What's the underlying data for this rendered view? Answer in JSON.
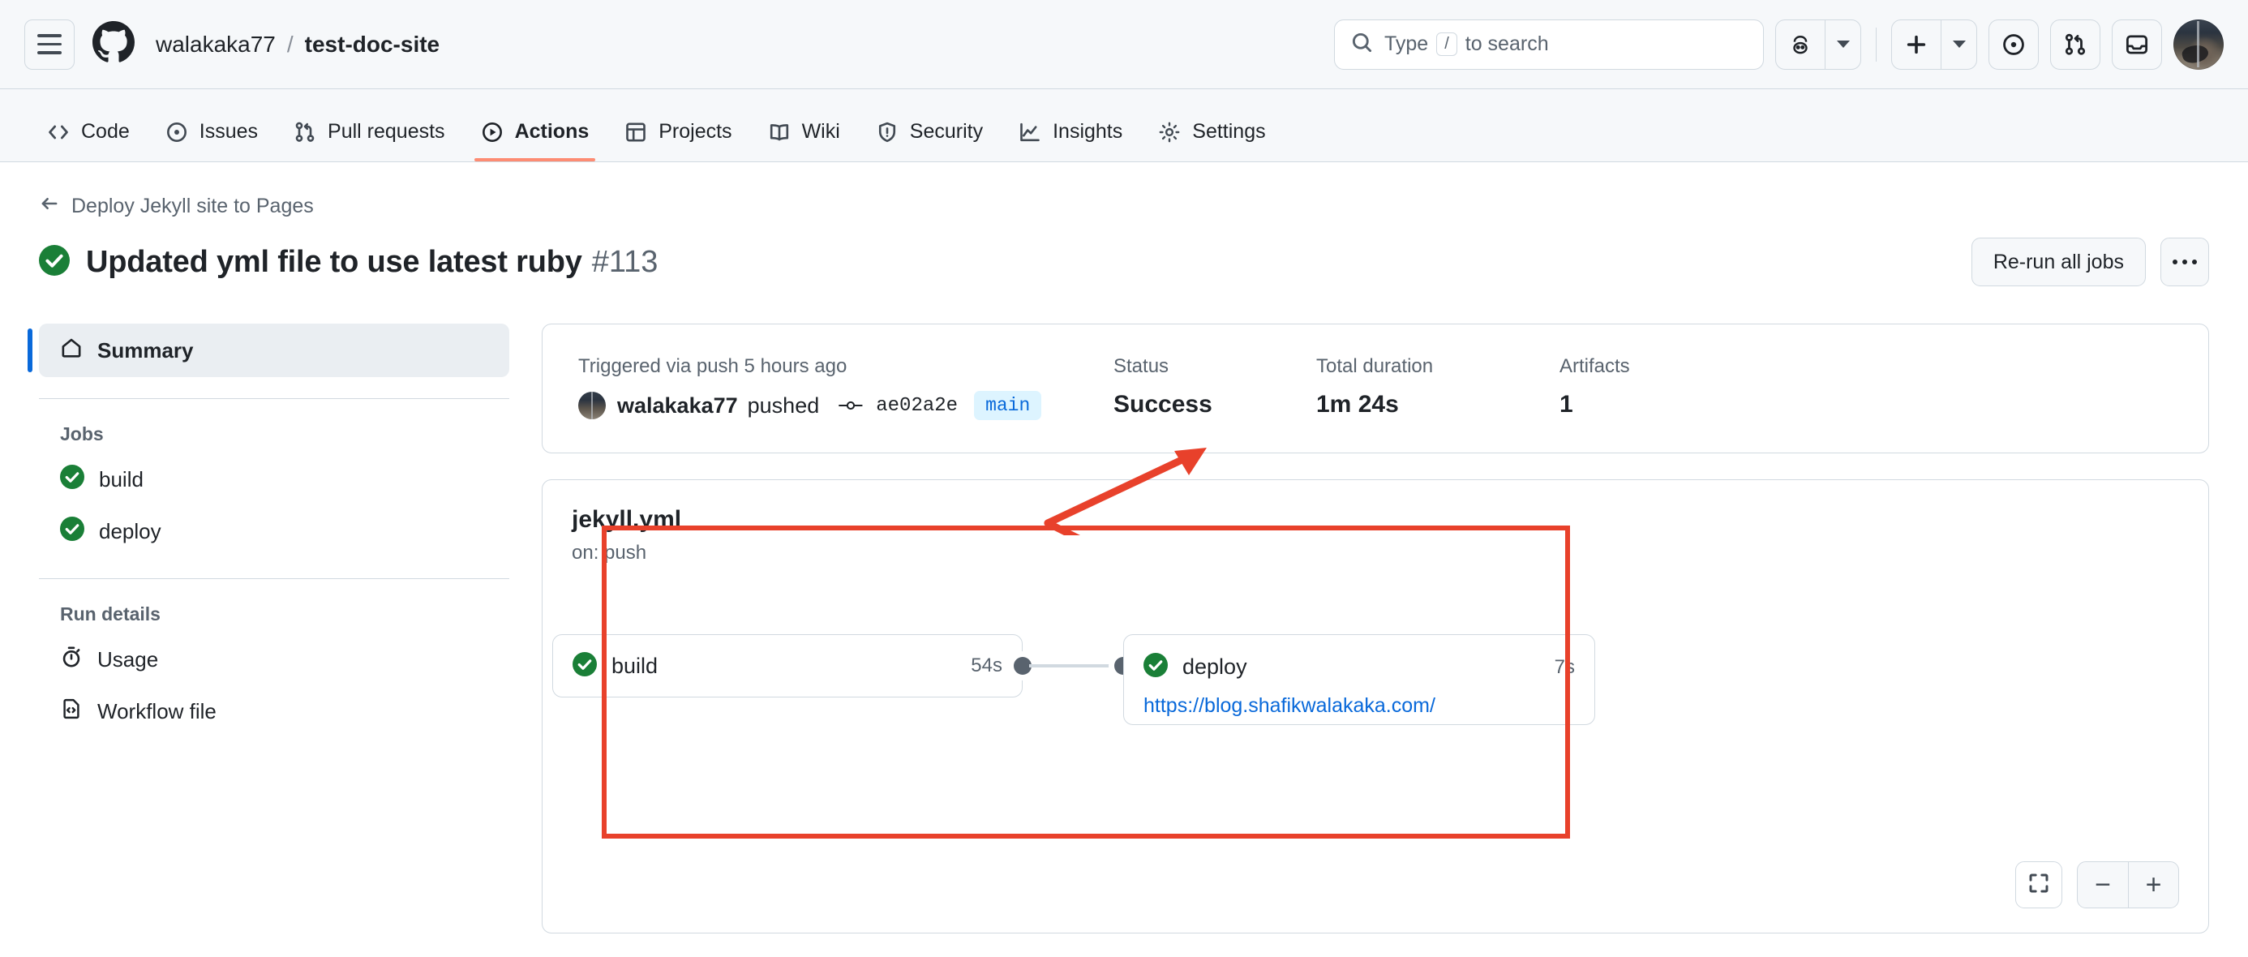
{
  "header": {
    "owner": "walakaka77",
    "separator": "/",
    "repo": "test-doc-site",
    "search_placeholder_pre": "Type",
    "search_slash_key": "/",
    "search_placeholder_post": "to search"
  },
  "repo_nav": [
    {
      "label": "Code",
      "icon": "code-icon",
      "active": false
    },
    {
      "label": "Issues",
      "icon": "issue-opened-icon",
      "active": false
    },
    {
      "label": "Pull requests",
      "icon": "git-pull-request-icon",
      "active": false
    },
    {
      "label": "Actions",
      "icon": "play-icon",
      "active": true
    },
    {
      "label": "Projects",
      "icon": "table-icon",
      "active": false
    },
    {
      "label": "Wiki",
      "icon": "book-icon",
      "active": false
    },
    {
      "label": "Security",
      "icon": "shield-icon",
      "active": false
    },
    {
      "label": "Insights",
      "icon": "graph-icon",
      "active": false
    },
    {
      "label": "Settings",
      "icon": "gear-icon",
      "active": false
    }
  ],
  "run": {
    "back_label": "Deploy Jekyll site to Pages",
    "title": "Updated yml file to use latest ruby",
    "number": "#113",
    "status_icon": "success-check-icon",
    "rerun_label": "Re-run all jobs",
    "kebab_label": "More options"
  },
  "sidebar": {
    "summary_label": "Summary",
    "jobs_heading": "Jobs",
    "jobs": [
      {
        "name": "build",
        "status": "success"
      },
      {
        "name": "deploy",
        "status": "success"
      }
    ],
    "run_details_heading": "Run details",
    "run_details": [
      {
        "label": "Usage",
        "icon": "stopwatch-icon"
      },
      {
        "label": "Workflow file",
        "icon": "file-code-icon"
      }
    ]
  },
  "summary": {
    "triggered_text": "Triggered via push 5 hours ago",
    "actor": "walakaka77",
    "action_verb": "pushed",
    "commit_sha": "ae02a2e",
    "branch": "main",
    "status_label": "Status",
    "status_value": "Success",
    "duration_label": "Total duration",
    "duration_value": "1m 24s",
    "artifacts_label": "Artifacts",
    "artifacts_value": "1"
  },
  "workflow_graph": {
    "file_name": "jekyll.yml",
    "trigger": "on: push",
    "nodes": [
      {
        "name": "build",
        "duration": "54s",
        "status": "success",
        "link": null
      },
      {
        "name": "deploy",
        "duration": "7s",
        "status": "success",
        "link": "https://blog.shafikwalakaka.com/"
      }
    ],
    "zoom_controls": {
      "fit_icon": "fit-screen-icon",
      "zoom_out": "−",
      "zoom_in": "+"
    }
  },
  "annotations": {
    "highlight_color": "#e8412b",
    "arrow_color": "#e8412b",
    "box_target": "workflow-graph-jekyll-yml",
    "arrow_targets": [
      "status-value-success",
      "workflow-graph-highlight-box"
    ]
  },
  "colors": {
    "success_green": "#1a7f37",
    "link_blue": "#0969da",
    "active_tab_underline": "#fd8c73",
    "sidebar_active_rail": "#0969da",
    "border": "#d1d9e0",
    "muted_text": "#59636e"
  }
}
